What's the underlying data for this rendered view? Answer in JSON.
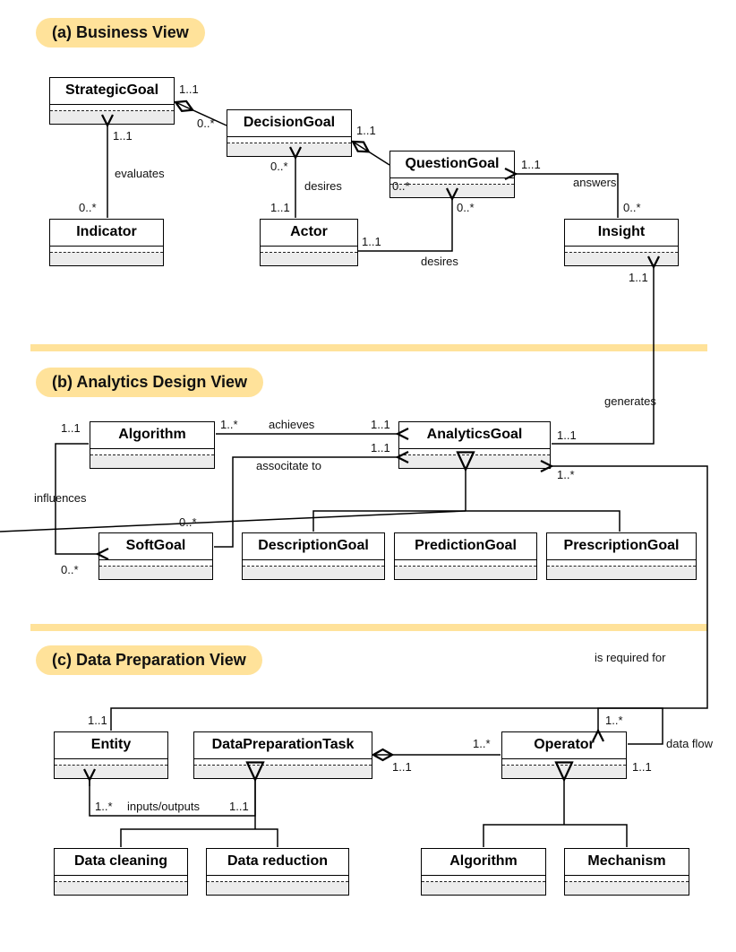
{
  "sections": {
    "a": "(a)  Business View",
    "b": "(b)  Analytics Design View",
    "c": "(c)  Data Preparation View"
  },
  "classes": {
    "strategicGoal": "StrategicGoal",
    "decisionGoal": "DecisionGoal",
    "questionGoal": "QuestionGoal",
    "indicator": "Indicator",
    "actor": "Actor",
    "insight": "Insight",
    "algorithmA": "Algorithm",
    "analyticsGoal": "AnalyticsGoal",
    "softGoal": "SoftGoal",
    "descriptionGoal": "DescriptionGoal",
    "predictionGoal": "PredictionGoal",
    "prescriptionGoal": "PrescriptionGoal",
    "entity": "Entity",
    "dataPrepTask": "DataPreparationTask",
    "operator": "Operator",
    "dataCleaning": "Data cleaning",
    "dataReduction": "Data reduction",
    "algorithmC": "Algorithm",
    "mechanism": "Mechanism"
  },
  "labels": {
    "evaluates": "evaluates",
    "desires1": "desires",
    "desires2": "desires",
    "answers": "answers",
    "achieves": "achieves",
    "associateTo": "associtate to",
    "influences": "influences",
    "generates": "generates",
    "isRequiredFor": "is required for",
    "inputsOutputs": "inputs/outputs",
    "dataFlow": "data flow"
  },
  "mult": {
    "m1_1": "1..1",
    "m0_s": "0..*",
    "m1_s": "1..*"
  }
}
